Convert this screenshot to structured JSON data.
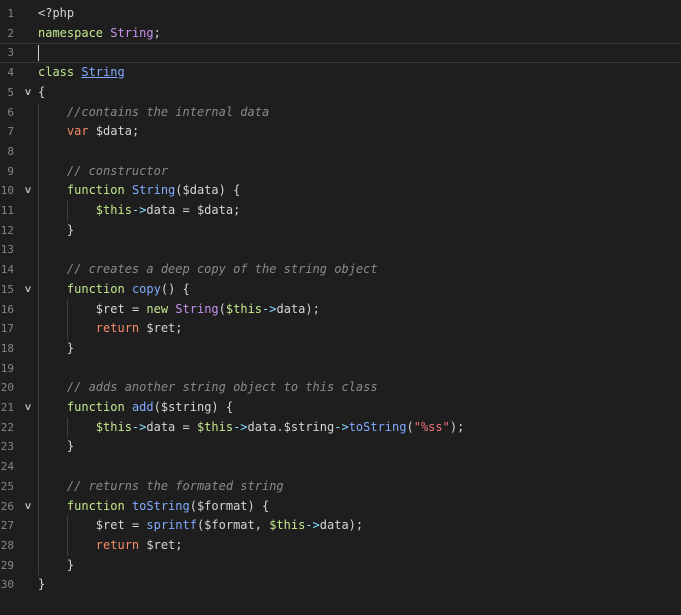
{
  "editor": {
    "lines": [
      {
        "num": "1",
        "fold": "",
        "tokens": [
          {
            "c": "pun",
            "t": "<?php"
          }
        ]
      },
      {
        "num": "2",
        "fold": "",
        "tokens": [
          {
            "c": "var",
            "t": "namespace"
          },
          {
            "c": "pun",
            "t": " "
          },
          {
            "c": "ns",
            "t": "String"
          },
          {
            "c": "pun",
            "t": ";"
          }
        ]
      },
      {
        "num": "3",
        "fold": "",
        "tokens": [],
        "current": true
      },
      {
        "num": "4",
        "fold": "",
        "tokens": [
          {
            "c": "var",
            "t": "class"
          },
          {
            "c": "pun",
            "t": " "
          },
          {
            "c": "cn",
            "t": "String"
          }
        ]
      },
      {
        "num": "5",
        "fold": "v",
        "tokens": [
          {
            "c": "pun",
            "t": "{"
          }
        ]
      },
      {
        "num": "6",
        "fold": "",
        "tokens": [
          {
            "c": "pun",
            "t": "    "
          },
          {
            "c": "cmt",
            "t": "//contains the internal data"
          }
        ]
      },
      {
        "num": "7",
        "fold": "",
        "tokens": [
          {
            "c": "pun",
            "t": "    "
          },
          {
            "c": "gold",
            "t": "var"
          },
          {
            "c": "pun",
            "t": " $data;"
          }
        ]
      },
      {
        "num": "8",
        "fold": "",
        "tokens": []
      },
      {
        "num": "9",
        "fold": "",
        "tokens": [
          {
            "c": "pun",
            "t": "    "
          },
          {
            "c": "cmt",
            "t": "// constructor"
          }
        ]
      },
      {
        "num": "10",
        "fold": "v",
        "tokens": [
          {
            "c": "pun",
            "t": "    "
          },
          {
            "c": "var",
            "t": "function"
          },
          {
            "c": "pun",
            "t": " "
          },
          {
            "c": "fn",
            "t": "String"
          },
          {
            "c": "pun",
            "t": "($data) {"
          }
        ]
      },
      {
        "num": "11",
        "fold": "",
        "tokens": [
          {
            "c": "pun",
            "t": "        "
          },
          {
            "c": "var",
            "t": "$this"
          },
          {
            "c": "arr",
            "t": "->"
          },
          {
            "c": "pun",
            "t": "data = $data;"
          }
        ]
      },
      {
        "num": "12",
        "fold": "",
        "tokens": [
          {
            "c": "pun",
            "t": "    }"
          }
        ]
      },
      {
        "num": "13",
        "fold": "",
        "tokens": []
      },
      {
        "num": "14",
        "fold": "",
        "tokens": [
          {
            "c": "pun",
            "t": "    "
          },
          {
            "c": "cmt",
            "t": "// creates a deep copy of the string object"
          }
        ]
      },
      {
        "num": "15",
        "fold": "v",
        "tokens": [
          {
            "c": "pun",
            "t": "    "
          },
          {
            "c": "var",
            "t": "function"
          },
          {
            "c": "pun",
            "t": " "
          },
          {
            "c": "fn",
            "t": "copy"
          },
          {
            "c": "pun",
            "t": "() {"
          }
        ]
      },
      {
        "num": "16",
        "fold": "",
        "tokens": [
          {
            "c": "pun",
            "t": "        "
          },
          {
            "c": "pun",
            "t": "$ret = "
          },
          {
            "c": "var",
            "t": "new"
          },
          {
            "c": "pun",
            "t": " "
          },
          {
            "c": "ns",
            "t": "String"
          },
          {
            "c": "pun",
            "t": "("
          },
          {
            "c": "var",
            "t": "$this"
          },
          {
            "c": "arr",
            "t": "->"
          },
          {
            "c": "pun",
            "t": "data);"
          }
        ]
      },
      {
        "num": "17",
        "fold": "",
        "tokens": [
          {
            "c": "pun",
            "t": "        "
          },
          {
            "c": "gold",
            "t": "return"
          },
          {
            "c": "pun",
            "t": " $ret;"
          }
        ]
      },
      {
        "num": "18",
        "fold": "",
        "tokens": [
          {
            "c": "pun",
            "t": "    }"
          }
        ]
      },
      {
        "num": "19",
        "fold": "",
        "tokens": []
      },
      {
        "num": "20",
        "fold": "",
        "tokens": [
          {
            "c": "pun",
            "t": "    "
          },
          {
            "c": "cmt",
            "t": "// adds another string object to this class"
          }
        ]
      },
      {
        "num": "21",
        "fold": "v",
        "tokens": [
          {
            "c": "pun",
            "t": "    "
          },
          {
            "c": "var",
            "t": "function"
          },
          {
            "c": "pun",
            "t": " "
          },
          {
            "c": "fn",
            "t": "add"
          },
          {
            "c": "pun",
            "t": "($string) {"
          }
        ]
      },
      {
        "num": "22",
        "fold": "",
        "tokens": [
          {
            "c": "pun",
            "t": "        "
          },
          {
            "c": "var",
            "t": "$this"
          },
          {
            "c": "arr",
            "t": "->"
          },
          {
            "c": "pun",
            "t": "data = "
          },
          {
            "c": "var",
            "t": "$this"
          },
          {
            "c": "arr",
            "t": "->"
          },
          {
            "c": "pun",
            "t": "data.$string"
          },
          {
            "c": "arr",
            "t": "->"
          },
          {
            "c": "fn",
            "t": "toString"
          },
          {
            "c": "pun",
            "t": "("
          },
          {
            "c": "str",
            "t": "\"%ss\""
          },
          {
            "c": "pun",
            "t": ");"
          }
        ]
      },
      {
        "num": "23",
        "fold": "",
        "tokens": [
          {
            "c": "pun",
            "t": "    }"
          }
        ]
      },
      {
        "num": "24",
        "fold": "",
        "tokens": []
      },
      {
        "num": "25",
        "fold": "",
        "tokens": [
          {
            "c": "pun",
            "t": "    "
          },
          {
            "c": "cmt",
            "t": "// returns the formated string"
          }
        ]
      },
      {
        "num": "26",
        "fold": "v",
        "tokens": [
          {
            "c": "pun",
            "t": "    "
          },
          {
            "c": "var",
            "t": "function"
          },
          {
            "c": "pun",
            "t": " "
          },
          {
            "c": "fn",
            "t": "toString"
          },
          {
            "c": "pun",
            "t": "($format) {"
          }
        ]
      },
      {
        "num": "27",
        "fold": "",
        "tokens": [
          {
            "c": "pun",
            "t": "        "
          },
          {
            "c": "pun",
            "t": "$ret = "
          },
          {
            "c": "fn",
            "t": "sprintf"
          },
          {
            "c": "pun",
            "t": "($format, "
          },
          {
            "c": "var",
            "t": "$this"
          },
          {
            "c": "arr",
            "t": "->"
          },
          {
            "c": "pun",
            "t": "data);"
          }
        ]
      },
      {
        "num": "28",
        "fold": "",
        "tokens": [
          {
            "c": "pun",
            "t": "        "
          },
          {
            "c": "gold",
            "t": "return"
          },
          {
            "c": "pun",
            "t": " $ret;"
          }
        ]
      },
      {
        "num": "29",
        "fold": "",
        "tokens": [
          {
            "c": "pun",
            "t": "    }"
          }
        ]
      },
      {
        "num": "30",
        "fold": "",
        "tokens": [
          {
            "c": "pun",
            "t": "}"
          }
        ]
      }
    ]
  },
  "colors": {
    "background": "#1e1e1e",
    "line_number": "#858585",
    "comment": "#8a8a8a",
    "keyword": "#c3e88d",
    "function": "#82aaff",
    "class_ref": "#c792ea",
    "string": "#f07178"
  }
}
